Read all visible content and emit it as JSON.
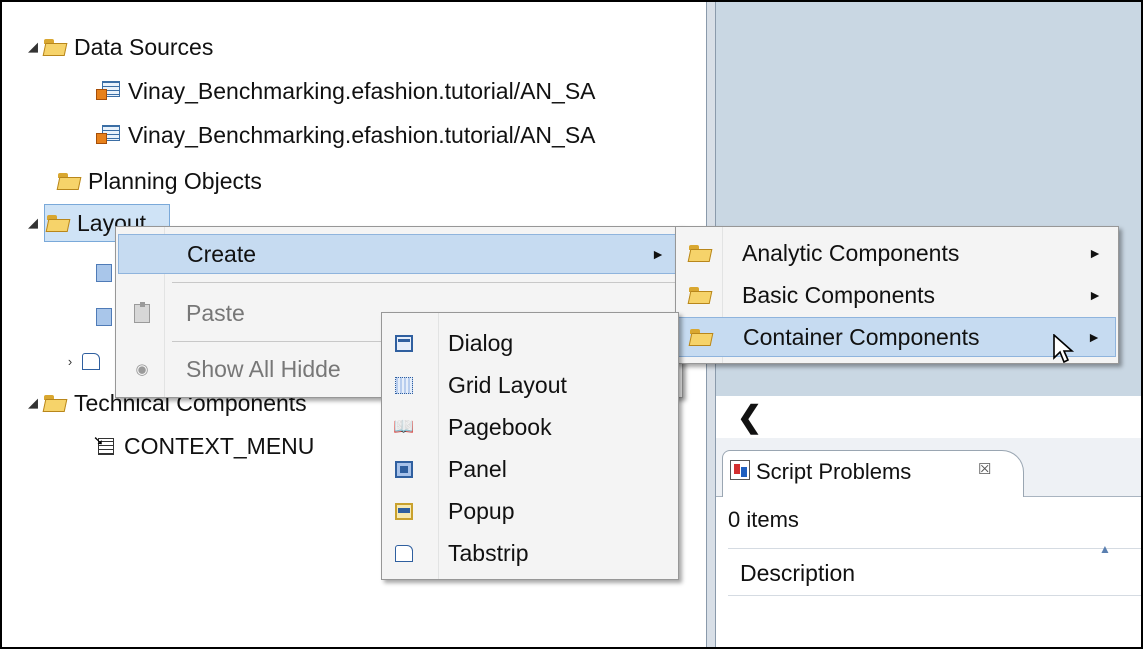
{
  "tree": {
    "items": [
      {
        "label": "Data Sources",
        "twisty": "◢"
      },
      {
        "label": "Vinay_Benchmarking.efashion.tutorial/AN_SA"
      },
      {
        "label": "Vinay_Benchmarking.efashion.tutorial/AN_SA"
      },
      {
        "label": "Planning Objects"
      },
      {
        "label": "Layout",
        "twisty": "◢"
      },
      {
        "label": "Technical Components",
        "twisty": "◢"
      },
      {
        "label": "CONTEXT_MENU"
      }
    ],
    "collapsed_twisty": "›"
  },
  "context_menu": {
    "items": [
      {
        "label": "Create",
        "state": "highlighted"
      },
      {
        "label": "Paste",
        "state": "disabled"
      },
      {
        "label": "Show All Hidde",
        "state": "disabled"
      }
    ]
  },
  "create_submenu": {
    "items": [
      {
        "label": "Analytic Components"
      },
      {
        "label": "Basic Components"
      },
      {
        "label": "Container Components",
        "state": "highlighted"
      }
    ]
  },
  "container_submenu": {
    "items": [
      {
        "label": "Dialog",
        "icon": "dialog-icon"
      },
      {
        "label": "Grid Layout",
        "icon": "grid-layout-icon"
      },
      {
        "label": "Pagebook",
        "icon": "pagebook-icon"
      },
      {
        "label": "Panel",
        "icon": "panel-icon"
      },
      {
        "label": "Popup",
        "icon": "popup-icon"
      },
      {
        "label": "Tabstrip",
        "icon": "tabstrip-icon"
      }
    ]
  },
  "right_pane": {
    "back_glyph": "❮",
    "view_tab": {
      "label": "Script Problems",
      "close": "☒"
    },
    "item_count": "0 items",
    "column_header": "Description",
    "sort_glyph": "▲"
  },
  "icons": {
    "submenu_arrow": "►"
  },
  "colors": {
    "highlight": "#c6dbf1",
    "editor_bg": "#c9d7e3",
    "menu_bg": "#f4f4f4"
  }
}
